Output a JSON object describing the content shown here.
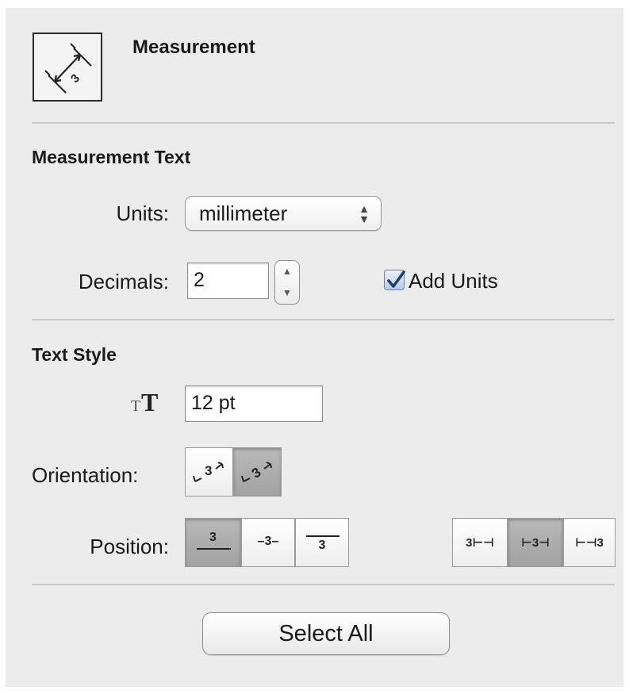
{
  "header": {
    "title": "Measurement",
    "icon": "measurement-tool-icon",
    "icon_digit": "3"
  },
  "measurement_text": {
    "heading": "Measurement Text",
    "units_label": "Units:",
    "units_value": "millimeter",
    "decimals_label": "Decimals:",
    "decimals_value": "2",
    "add_units_label": "Add Units",
    "add_units_checked": true
  },
  "text_style": {
    "heading": "Text Style",
    "font_size_icon": "text-size-icon",
    "font_size_value": "12 pt",
    "orientation_label": "Orientation:",
    "orientation_options": [
      {
        "glyph": "3",
        "icon": "orientation-parallel-icon",
        "selected": false
      },
      {
        "glyph": "3",
        "icon": "orientation-rotated-icon",
        "selected": true
      }
    ],
    "position_label": "Position:",
    "vertical_position_options": [
      {
        "glyph": "3",
        "icon": "text-above-line-icon",
        "selected": true
      },
      {
        "glyph": "–3–",
        "icon": "text-on-line-icon",
        "selected": false
      },
      {
        "glyph": "3",
        "icon": "text-below-line-icon",
        "selected": false
      }
    ],
    "horizontal_position_options": [
      {
        "glyph": "3⊢⊣",
        "icon": "text-left-icon",
        "selected": false
      },
      {
        "glyph": "⊢3⊣",
        "icon": "text-center-icon",
        "selected": true
      },
      {
        "glyph": "⊢⊣3",
        "icon": "text-right-icon",
        "selected": false
      }
    ]
  },
  "actions": {
    "select_all_label": "Select All"
  },
  "colors": {
    "panel_bg": "#ececec",
    "checkbox_accent": "#2a5ea8",
    "segment_selected": "#a9a9a9"
  }
}
